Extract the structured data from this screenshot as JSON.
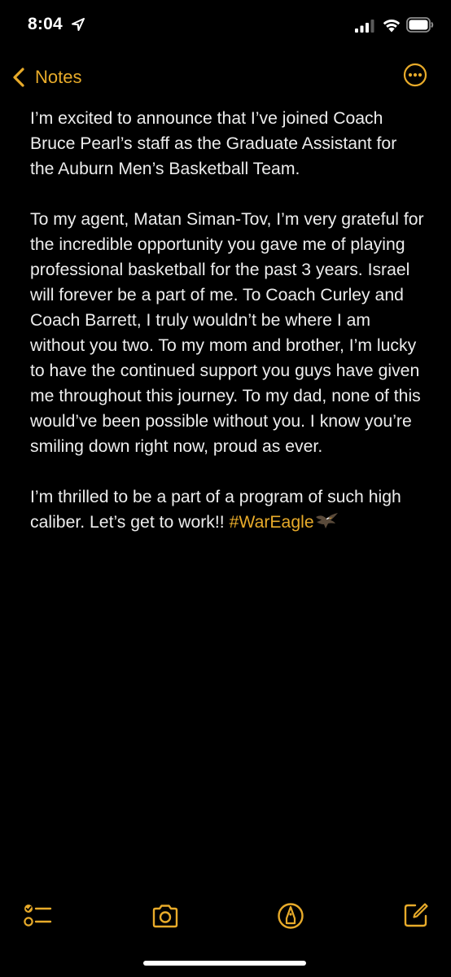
{
  "status_bar": {
    "time": "8:04",
    "icons": [
      "location-arrow-icon",
      "cellular-signal-icon",
      "wifi-icon",
      "battery-icon"
    ]
  },
  "nav": {
    "back_label": "Notes",
    "more_icon": "ellipsis-circle-icon"
  },
  "note": {
    "paragraph_1": "I’m excited to announce that I’ve joined Coach Bruce Pearl’s staff as the Graduate Assistant for the Auburn Men’s Basketball Team.",
    "paragraph_2": "To my agent, Matan Siman-Tov, I’m very grateful for the incredible opportunity you gave me of playing professional basketball for the past 3 years. Israel will forever be a part of me. To Coach Curley and Coach Barrett, I truly wouldn’t be where I am without you two. To my mom and brother, I’m lucky to have the continued support you guys have given me throughout this journey. To my dad, none of this would’ve been possible without you. I know you’re smiling down right now, proud as ever.",
    "paragraph_3_text": "I’m thrilled to be a part of a program of such high caliber. Let’s get to work!! ",
    "paragraph_3_hashtag": "#WarEagle",
    "emoji": "eagle-emoji"
  },
  "toolbar": {
    "icons": [
      "checklist-icon",
      "camera-icon",
      "markup-pen-icon",
      "compose-icon"
    ]
  },
  "colors": {
    "accent": "#e8ab2a",
    "background": "#000000",
    "text": "#ededed"
  }
}
